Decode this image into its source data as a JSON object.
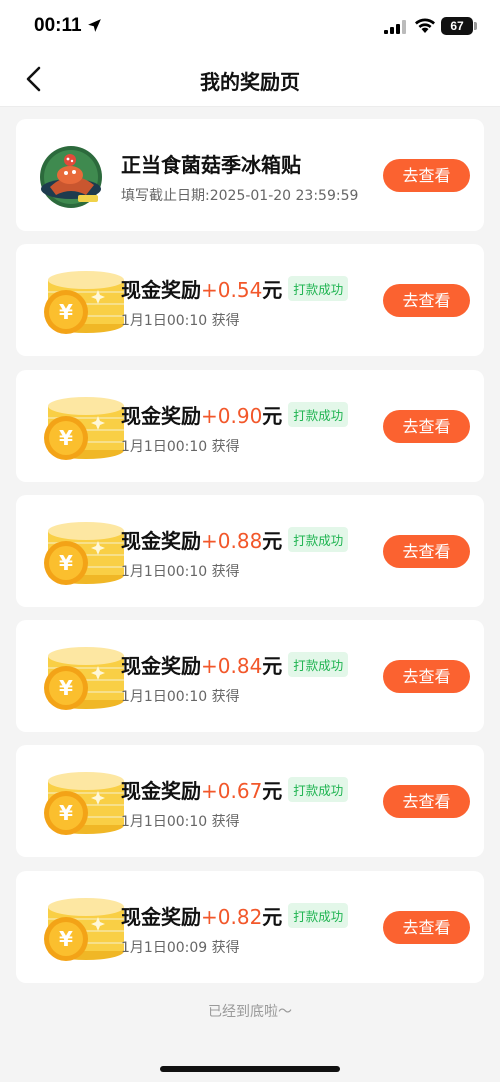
{
  "status_bar": {
    "time": "00:11",
    "battery": "67",
    "icons": [
      "location-arrow-icon",
      "signal-icon",
      "wifi-icon",
      "battery-icon"
    ]
  },
  "nav": {
    "title": "我的奖励页",
    "back_icon": "chevron-left-icon"
  },
  "rewards": [
    {
      "type": "coupon",
      "icon": "mushroom-fridge-sticker-image",
      "title": "正当食菌菇季冰箱贴",
      "subtitle": "填写截止日期:2025-01-20 23:59:59",
      "button": "去查看"
    },
    {
      "type": "cash",
      "icon": "coin-stack-icon",
      "title": "现金奖励",
      "amount": "+0.54",
      "unit": "元",
      "badge": "打款成功",
      "subtitle": "1月1日00:10 获得",
      "button": "去查看"
    },
    {
      "type": "cash",
      "icon": "coin-stack-icon",
      "title": "现金奖励",
      "amount": "+0.90",
      "unit": "元",
      "badge": "打款成功",
      "subtitle": "1月1日00:10 获得",
      "button": "去查看"
    },
    {
      "type": "cash",
      "icon": "coin-stack-icon",
      "title": "现金奖励",
      "amount": "+0.88",
      "unit": "元",
      "badge": "打款成功",
      "subtitle": "1月1日00:10 获得",
      "button": "去查看"
    },
    {
      "type": "cash",
      "icon": "coin-stack-icon",
      "title": "现金奖励",
      "amount": "+0.84",
      "unit": "元",
      "badge": "打款成功",
      "subtitle": "1月1日00:10 获得",
      "button": "去查看"
    },
    {
      "type": "cash",
      "icon": "coin-stack-icon",
      "title": "现金奖励",
      "amount": "+0.67",
      "unit": "元",
      "badge": "打款成功",
      "subtitle": "1月1日00:10 获得",
      "button": "去查看"
    },
    {
      "type": "cash",
      "icon": "coin-stack-icon",
      "title": "现金奖励",
      "amount": "+0.82",
      "unit": "元",
      "badge": "打款成功",
      "subtitle": "1月1日00:09 获得",
      "button": "去查看"
    }
  ],
  "footer": {
    "text": "已经到底啦～"
  },
  "colors": {
    "accent": "#fb6230",
    "amount": "#f2572a",
    "badge_bg": "#e3f7e9",
    "badge_text": "#1fb451",
    "page_bg": "#f4f4f4"
  }
}
